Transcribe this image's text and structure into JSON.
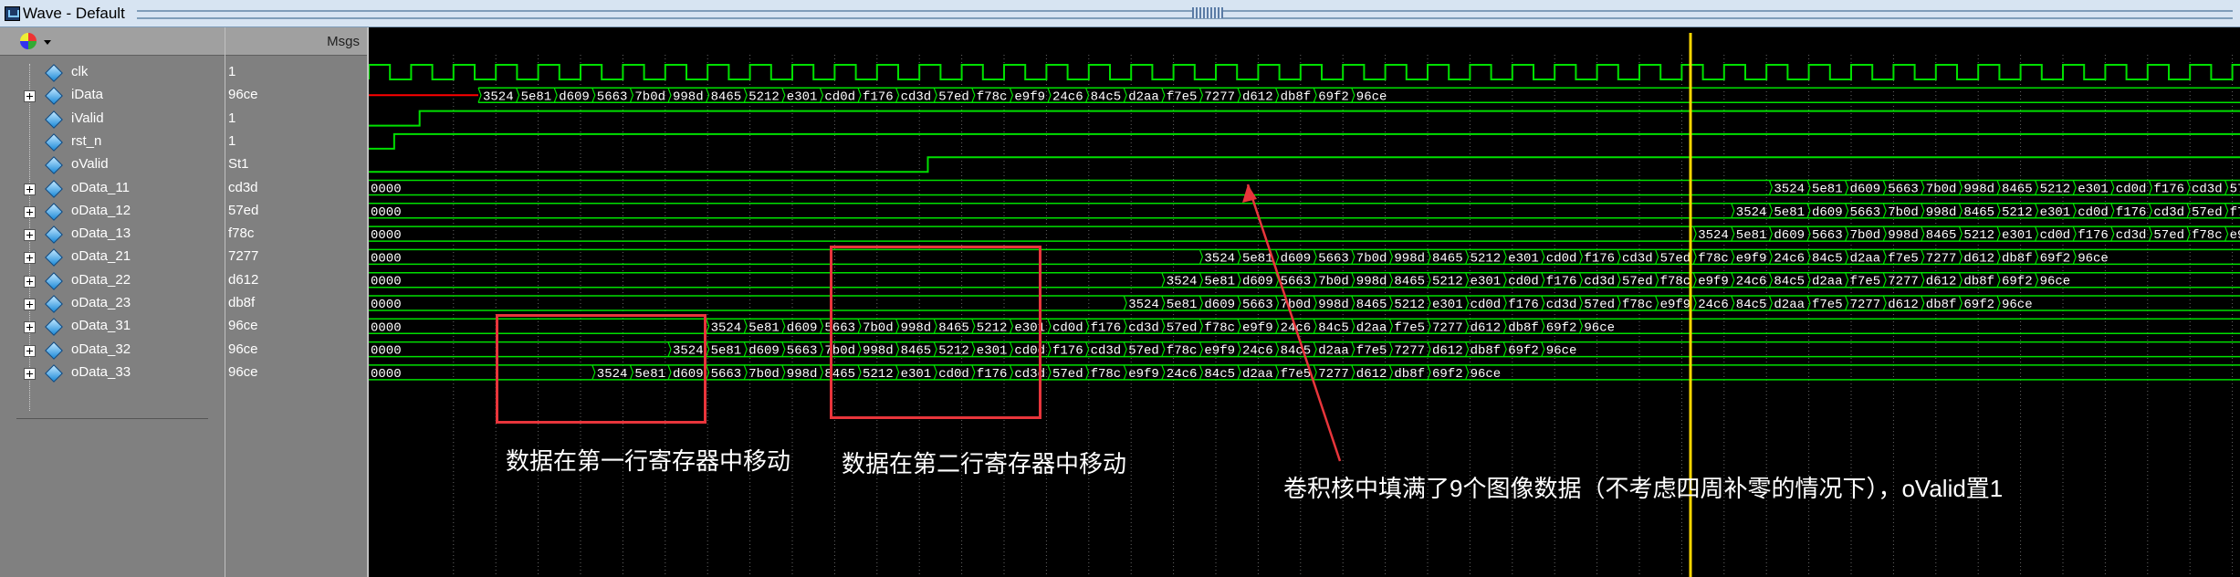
{
  "window": {
    "title": "Wave - Default"
  },
  "header": {
    "msgs_label": "Msgs",
    "manager_icon": "wave-manager-icon"
  },
  "signals": [
    {
      "name": "clk",
      "value": "1",
      "expandable": false
    },
    {
      "name": "iData",
      "value": "96ce",
      "expandable": true
    },
    {
      "name": "iValid",
      "value": "1",
      "expandable": false
    },
    {
      "name": "rst_n",
      "value": "1",
      "expandable": false
    },
    {
      "name": "oValid",
      "value": "St1",
      "expandable": false
    },
    {
      "name": "oData_11",
      "value": "cd3d",
      "expandable": true
    },
    {
      "name": "oData_12",
      "value": "57ed",
      "expandable": true
    },
    {
      "name": "oData_13",
      "value": "f78c",
      "expandable": true
    },
    {
      "name": "oData_21",
      "value": "7277",
      "expandable": true
    },
    {
      "name": "oData_22",
      "value": "d612",
      "expandable": true
    },
    {
      "name": "oData_23",
      "value": "db8f",
      "expandable": true
    },
    {
      "name": "oData_31",
      "value": "96ce",
      "expandable": true
    },
    {
      "name": "oData_32",
      "value": "96ce",
      "expandable": true
    },
    {
      "name": "oData_33",
      "value": "96ce",
      "expandable": true
    }
  ],
  "data_sequence": [
    "3524",
    "5e81",
    "d609",
    "5663",
    "7b0d",
    "998d",
    "8465",
    "5212",
    "e301",
    "cd0d",
    "f176",
    "cd3d",
    "57ed",
    "f78c",
    "e9f9",
    "24c6",
    "84c5",
    "d2aa",
    "f7e5",
    "7277",
    "d612",
    "db8f",
    "69f2",
    "96ce"
  ],
  "reset_value": "0000",
  "bus_start_cycle": {
    "iData": 3,
    "oData_11": 37,
    "oData_12": 36,
    "oData_13": 35,
    "oData_21": 22,
    "oData_22": 21,
    "oData_23": 20,
    "oData_31": 9,
    "oData_32": 8,
    "oData_33": 6
  },
  "annotations": {
    "row1_move": "数据在第一行寄存器中移动",
    "row2_move": "数据在第二行寄存器中移动",
    "valid_note": "卷积核中填满了9个图像数据（不考虑四周补零的情况下），oValid置1"
  },
  "colors": {
    "wave": "#00e000",
    "cursor": "#ffd700",
    "annotation_box": "#e8353b",
    "grid": "#666666",
    "init_segment": "#ff0000"
  }
}
